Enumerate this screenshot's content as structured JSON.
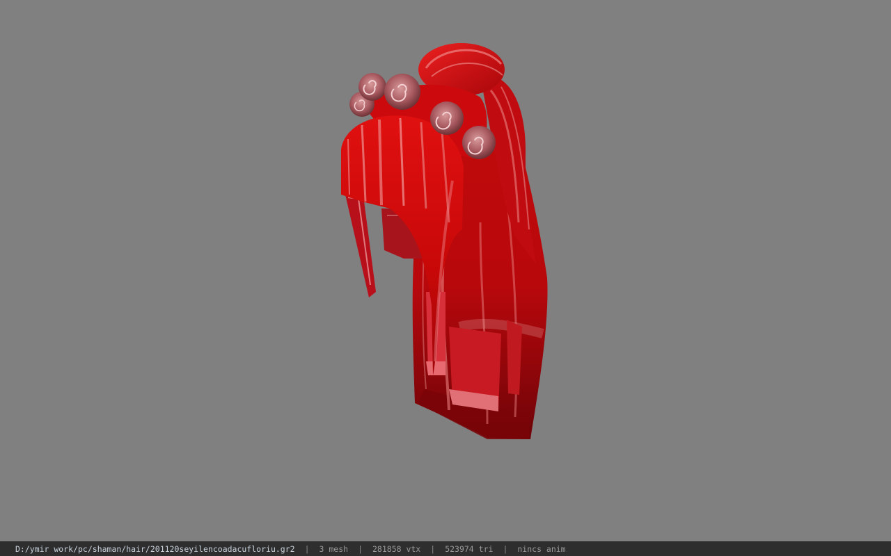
{
  "status": {
    "file_path": "D:/ymir work/pc/shaman/hair/201120seyilencoadacufloriu.gr2",
    "separator": "|",
    "mesh_count": "3 mesh",
    "vertex_count": "281858 vtx",
    "triangle_count": "523974 tri",
    "anim_status": "nincs anim"
  },
  "colors": {
    "background": "#808080",
    "statusbar": "#2e2e2e",
    "hair_main": "#d10a0a",
    "hair_dark": "#7a0308",
    "hair_highlight": "#e87a7a",
    "rose": "#b06a6e"
  },
  "viewport": {
    "model": "hair-model-with-rose-crown"
  }
}
